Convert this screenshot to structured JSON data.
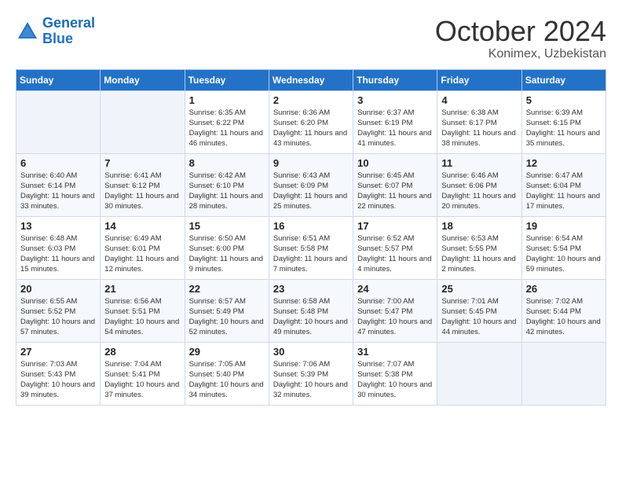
{
  "logo": {
    "line1": "General",
    "line2": "Blue"
  },
  "title": "October 2024",
  "subtitle": "Konimex, Uzbekistan",
  "days_of_week": [
    "Sunday",
    "Monday",
    "Tuesday",
    "Wednesday",
    "Thursday",
    "Friday",
    "Saturday"
  ],
  "weeks": [
    [
      {
        "day": "",
        "sunrise": "",
        "sunset": "",
        "daylight": ""
      },
      {
        "day": "",
        "sunrise": "",
        "sunset": "",
        "daylight": ""
      },
      {
        "day": "1",
        "sunrise": "Sunrise: 6:35 AM",
        "sunset": "Sunset: 6:22 PM",
        "daylight": "Daylight: 11 hours and 46 minutes."
      },
      {
        "day": "2",
        "sunrise": "Sunrise: 6:36 AM",
        "sunset": "Sunset: 6:20 PM",
        "daylight": "Daylight: 11 hours and 43 minutes."
      },
      {
        "day": "3",
        "sunrise": "Sunrise: 6:37 AM",
        "sunset": "Sunset: 6:19 PM",
        "daylight": "Daylight: 11 hours and 41 minutes."
      },
      {
        "day": "4",
        "sunrise": "Sunrise: 6:38 AM",
        "sunset": "Sunset: 6:17 PM",
        "daylight": "Daylight: 11 hours and 38 minutes."
      },
      {
        "day": "5",
        "sunrise": "Sunrise: 6:39 AM",
        "sunset": "Sunset: 6:15 PM",
        "daylight": "Daylight: 11 hours and 35 minutes."
      }
    ],
    [
      {
        "day": "6",
        "sunrise": "Sunrise: 6:40 AM",
        "sunset": "Sunset: 6:14 PM",
        "daylight": "Daylight: 11 hours and 33 minutes."
      },
      {
        "day": "7",
        "sunrise": "Sunrise: 6:41 AM",
        "sunset": "Sunset: 6:12 PM",
        "daylight": "Daylight: 11 hours and 30 minutes."
      },
      {
        "day": "8",
        "sunrise": "Sunrise: 6:42 AM",
        "sunset": "Sunset: 6:10 PM",
        "daylight": "Daylight: 11 hours and 28 minutes."
      },
      {
        "day": "9",
        "sunrise": "Sunrise: 6:43 AM",
        "sunset": "Sunset: 6:09 PM",
        "daylight": "Daylight: 11 hours and 25 minutes."
      },
      {
        "day": "10",
        "sunrise": "Sunrise: 6:45 AM",
        "sunset": "Sunset: 6:07 PM",
        "daylight": "Daylight: 11 hours and 22 minutes."
      },
      {
        "day": "11",
        "sunrise": "Sunrise: 6:46 AM",
        "sunset": "Sunset: 6:06 PM",
        "daylight": "Daylight: 11 hours and 20 minutes."
      },
      {
        "day": "12",
        "sunrise": "Sunrise: 6:47 AM",
        "sunset": "Sunset: 6:04 PM",
        "daylight": "Daylight: 11 hours and 17 minutes."
      }
    ],
    [
      {
        "day": "13",
        "sunrise": "Sunrise: 6:48 AM",
        "sunset": "Sunset: 6:03 PM",
        "daylight": "Daylight: 11 hours and 15 minutes."
      },
      {
        "day": "14",
        "sunrise": "Sunrise: 6:49 AM",
        "sunset": "Sunset: 6:01 PM",
        "daylight": "Daylight: 11 hours and 12 minutes."
      },
      {
        "day": "15",
        "sunrise": "Sunrise: 6:50 AM",
        "sunset": "Sunset: 6:00 PM",
        "daylight": "Daylight: 11 hours and 9 minutes."
      },
      {
        "day": "16",
        "sunrise": "Sunrise: 6:51 AM",
        "sunset": "Sunset: 5:58 PM",
        "daylight": "Daylight: 11 hours and 7 minutes."
      },
      {
        "day": "17",
        "sunrise": "Sunrise: 6:52 AM",
        "sunset": "Sunset: 5:57 PM",
        "daylight": "Daylight: 11 hours and 4 minutes."
      },
      {
        "day": "18",
        "sunrise": "Sunrise: 6:53 AM",
        "sunset": "Sunset: 5:55 PM",
        "daylight": "Daylight: 11 hours and 2 minutes."
      },
      {
        "day": "19",
        "sunrise": "Sunrise: 6:54 AM",
        "sunset": "Sunset: 5:54 PM",
        "daylight": "Daylight: 10 hours and 59 minutes."
      }
    ],
    [
      {
        "day": "20",
        "sunrise": "Sunrise: 6:55 AM",
        "sunset": "Sunset: 5:52 PM",
        "daylight": "Daylight: 10 hours and 57 minutes."
      },
      {
        "day": "21",
        "sunrise": "Sunrise: 6:56 AM",
        "sunset": "Sunset: 5:51 PM",
        "daylight": "Daylight: 10 hours and 54 minutes."
      },
      {
        "day": "22",
        "sunrise": "Sunrise: 6:57 AM",
        "sunset": "Sunset: 5:49 PM",
        "daylight": "Daylight: 10 hours and 52 minutes."
      },
      {
        "day": "23",
        "sunrise": "Sunrise: 6:58 AM",
        "sunset": "Sunset: 5:48 PM",
        "daylight": "Daylight: 10 hours and 49 minutes."
      },
      {
        "day": "24",
        "sunrise": "Sunrise: 7:00 AM",
        "sunset": "Sunset: 5:47 PM",
        "daylight": "Daylight: 10 hours and 47 minutes."
      },
      {
        "day": "25",
        "sunrise": "Sunrise: 7:01 AM",
        "sunset": "Sunset: 5:45 PM",
        "daylight": "Daylight: 10 hours and 44 minutes."
      },
      {
        "day": "26",
        "sunrise": "Sunrise: 7:02 AM",
        "sunset": "Sunset: 5:44 PM",
        "daylight": "Daylight: 10 hours and 42 minutes."
      }
    ],
    [
      {
        "day": "27",
        "sunrise": "Sunrise: 7:03 AM",
        "sunset": "Sunset: 5:43 PM",
        "daylight": "Daylight: 10 hours and 39 minutes."
      },
      {
        "day": "28",
        "sunrise": "Sunrise: 7:04 AM",
        "sunset": "Sunset: 5:41 PM",
        "daylight": "Daylight: 10 hours and 37 minutes."
      },
      {
        "day": "29",
        "sunrise": "Sunrise: 7:05 AM",
        "sunset": "Sunset: 5:40 PM",
        "daylight": "Daylight: 10 hours and 34 minutes."
      },
      {
        "day": "30",
        "sunrise": "Sunrise: 7:06 AM",
        "sunset": "Sunset: 5:39 PM",
        "daylight": "Daylight: 10 hours and 32 minutes."
      },
      {
        "day": "31",
        "sunrise": "Sunrise: 7:07 AM",
        "sunset": "Sunset: 5:38 PM",
        "daylight": "Daylight: 10 hours and 30 minutes."
      },
      {
        "day": "",
        "sunrise": "",
        "sunset": "",
        "daylight": ""
      },
      {
        "day": "",
        "sunrise": "",
        "sunset": "",
        "daylight": ""
      }
    ]
  ]
}
